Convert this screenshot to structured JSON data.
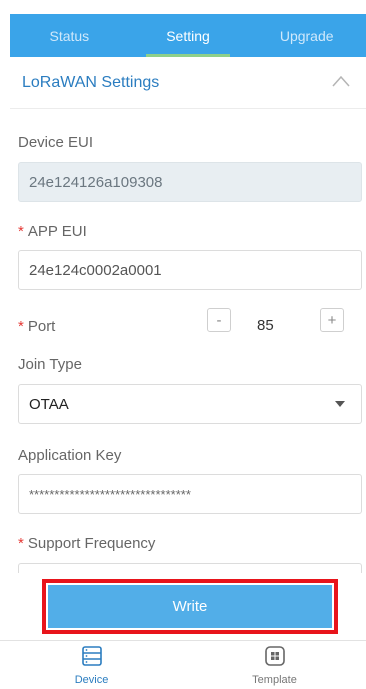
{
  "tabs": [
    {
      "label": "Status",
      "active": false
    },
    {
      "label": "Setting",
      "active": true
    },
    {
      "label": "Upgrade",
      "active": false
    }
  ],
  "section": {
    "title": "LoRaWAN Settings",
    "icon": "chevron-up-icon"
  },
  "form": {
    "device_eui": {
      "label": "Device EUI",
      "value": "24e124126a109308",
      "readonly": true
    },
    "app_eui": {
      "label": "APP EUI",
      "required_mark": "*",
      "value": "24e124c0002a0001"
    },
    "port": {
      "label": "Port",
      "required_mark": "*",
      "value": "85",
      "minus": "-",
      "plus": "+"
    },
    "join_type": {
      "label": "Join Type",
      "value": "OTAA"
    },
    "application_key": {
      "label": "Application Key",
      "value": "********************************"
    },
    "support_frequency": {
      "label": "Support Frequency",
      "required_mark": "*"
    }
  },
  "write_button": {
    "label": "Write",
    "highlight_color": "#e8141b"
  },
  "bottom_nav": [
    {
      "label": "Device",
      "icon": "device-list-icon",
      "active": true
    },
    {
      "label": "Template",
      "icon": "template-grid-icon",
      "active": false
    }
  ],
  "colors": {
    "accent": "#3aa4e9",
    "button": "#52aee8",
    "tab_indicator": "#8ed08a",
    "required": "#e53935"
  }
}
